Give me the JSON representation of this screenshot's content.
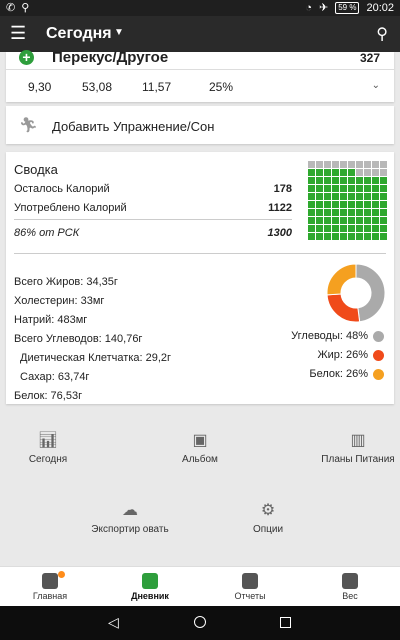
{
  "status_bar": {
    "time": "20:02",
    "battery": "59 %"
  },
  "app_bar": {
    "title": "Сегодня"
  },
  "meal": {
    "name": "Перекус/Другое",
    "calories": "327",
    "macros": [
      "9,30",
      "53,08",
      "11,57",
      "25%"
    ]
  },
  "exercise": {
    "label": "Добавить Упражнение/Сон"
  },
  "summary": {
    "title": "Сводка",
    "remaining_label": "Осталось Калорий",
    "remaining_value": "178",
    "consumed_label": "Употреблено Калорий",
    "consumed_value": "1122",
    "rdi_label": "86% от РСК",
    "rdi_value": "1300",
    "grid_filled_fraction": 0.86
  },
  "nutrients": {
    "fat": "Всего Жиров: 34,35г",
    "cholesterol": "Холестерин: 33мг",
    "sodium": "Натрий: 483мг",
    "carbs": "Всего Углеводов: 140,76г",
    "fiber": "Диетическая Клетчатка: 29,2г",
    "sugar": "Сахар: 63,74г",
    "protein": "Белок: 76,53г"
  },
  "chart_data": {
    "type": "pie",
    "categories": [
      "Углеводы",
      "Жир",
      "Белок"
    ],
    "values": [
      48,
      26,
      26
    ],
    "legend_labels": [
      "Углеводы: 48%",
      "Жир: 26%",
      "Белок: 26%"
    ],
    "colors": [
      "#aaaaaa",
      "#f04a1a",
      "#f5a020"
    ]
  },
  "actions": {
    "today": "Сегодня",
    "album": "Альбом",
    "meal_plans": "Планы Питания",
    "export": "Экспортир овать",
    "options": "Опции"
  },
  "bottom_nav": {
    "home": "Главная",
    "diary": "Дневник",
    "reports": "Отчеты",
    "weight": "Вес"
  }
}
